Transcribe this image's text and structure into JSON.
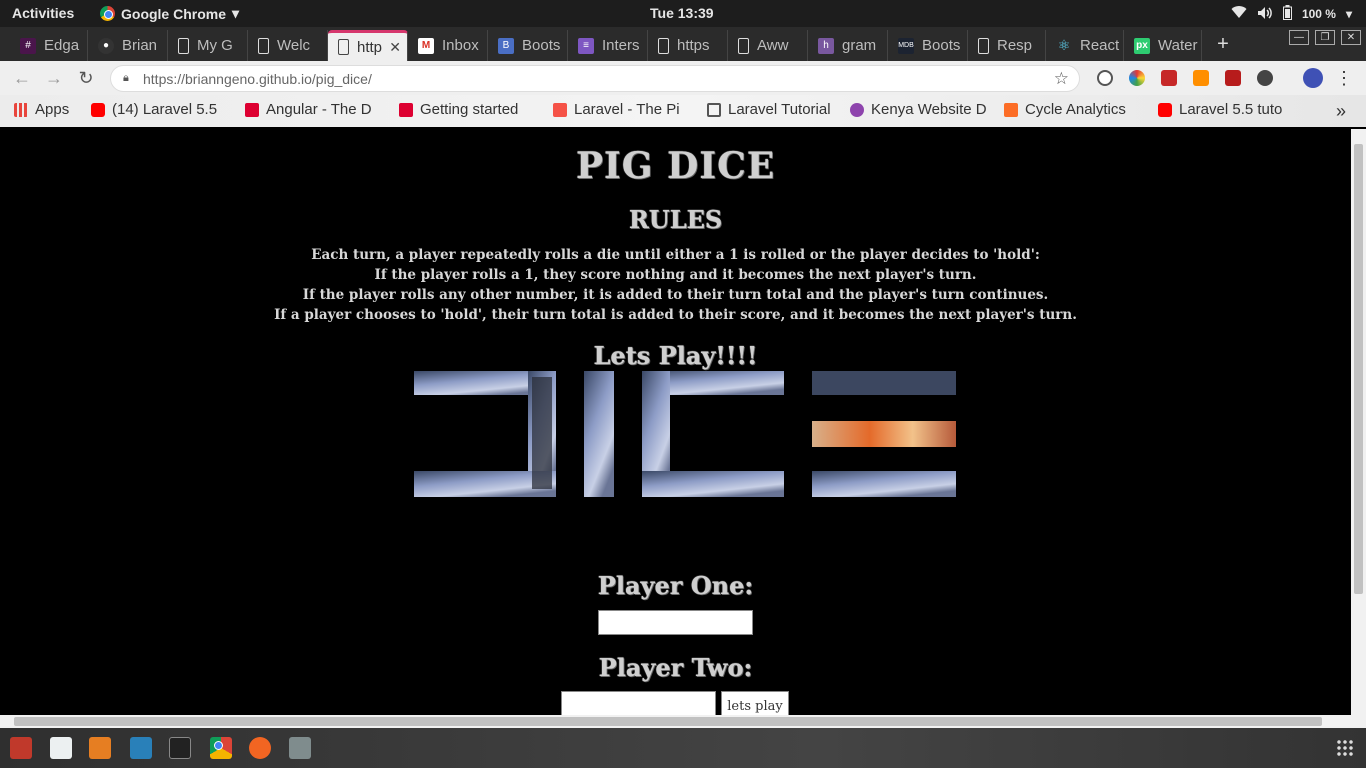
{
  "topbar": {
    "activities": "Activities",
    "app_name": "Google Chrome",
    "clock": "Tue 13:39",
    "battery": "100 %"
  },
  "tabs": [
    {
      "label": "Edga",
      "icon": "slack-icon",
      "color": "#4a154b"
    },
    {
      "label": "Brian",
      "icon": "github-icon",
      "color": "#333333"
    },
    {
      "label": "My G",
      "icon": "page-icon",
      "color": "#ffffff"
    },
    {
      "label": "Welc",
      "icon": "page-icon",
      "color": "#ffffff"
    },
    {
      "label": "http",
      "icon": "page-icon",
      "color": "#ffffff",
      "active": true
    },
    {
      "label": "Inbox",
      "icon": "gmail-icon",
      "color": "#d93025"
    },
    {
      "label": "Boots",
      "icon": "bootstrap-icon",
      "color": "#563d7c"
    },
    {
      "label": "Inters",
      "icon": "docs-icon",
      "color": "#7e57c2"
    },
    {
      "label": "https",
      "icon": "page-icon",
      "color": "#ffffff"
    },
    {
      "label": "Aww",
      "icon": "page-icon",
      "color": "#ffffff"
    },
    {
      "label": "gram",
      "icon": "heroku-icon",
      "color": "#79589f"
    },
    {
      "label": "Boots",
      "icon": "mdb-icon",
      "color": "#1c2331"
    },
    {
      "label": "Resp",
      "icon": "page-icon",
      "color": "#ffffff"
    },
    {
      "label": "React",
      "icon": "react-icon",
      "color": "#61dafb"
    },
    {
      "label": "Water",
      "icon": "px-icon",
      "color": "#2ecc71"
    }
  ],
  "toolbar": {
    "url": "https://brianngeno.github.io/pig_dice/"
  },
  "bookmarks": [
    {
      "label": "Apps",
      "icon": "apps-grid-icon",
      "color": "#e8453c"
    },
    {
      "label": "(14) Laravel 5.5",
      "icon": "youtube-icon",
      "color": "#ff0000"
    },
    {
      "label": "Angular - The D",
      "icon": "angular-icon",
      "color": "#dd0031"
    },
    {
      "label": "Getting started",
      "icon": "angular-icon",
      "color": "#dd0031"
    },
    {
      "label": "Laravel - The Pi",
      "icon": "laravel-icon",
      "color": "#f55247"
    },
    {
      "label": "Laravel Tutorial",
      "icon": "tutorial-icon",
      "color": "#555555"
    },
    {
      "label": "Kenya Website D",
      "icon": "site-icon",
      "color": "#8e44ad"
    },
    {
      "label": "Cycle Analytics",
      "icon": "gitlab-icon",
      "color": "#fc6d26"
    },
    {
      "label": "Laravel 5.5 tuto",
      "icon": "youtube-icon",
      "color": "#ff0000"
    }
  ],
  "page": {
    "title": "PIG DICE",
    "rules_heading": "RULES",
    "rules": [
      "Each turn, a player repeatedly rolls a die until either a 1 is rolled or the player decides to 'hold':",
      "If the player rolls a 1, they score nothing and it becomes the next player's turn.",
      "If the player rolls any other number, it is added to their turn total and the player's turn continues.",
      "If a player chooses to 'hold', their turn total is added to their score, and it becomes the next player's turn."
    ],
    "lets_play": "Lets Play!!!!",
    "player_one_label": "Player One:",
    "player_two_label": "Player Two:",
    "player_one_value": "",
    "player_two_value": "",
    "play_button": "lets play"
  }
}
